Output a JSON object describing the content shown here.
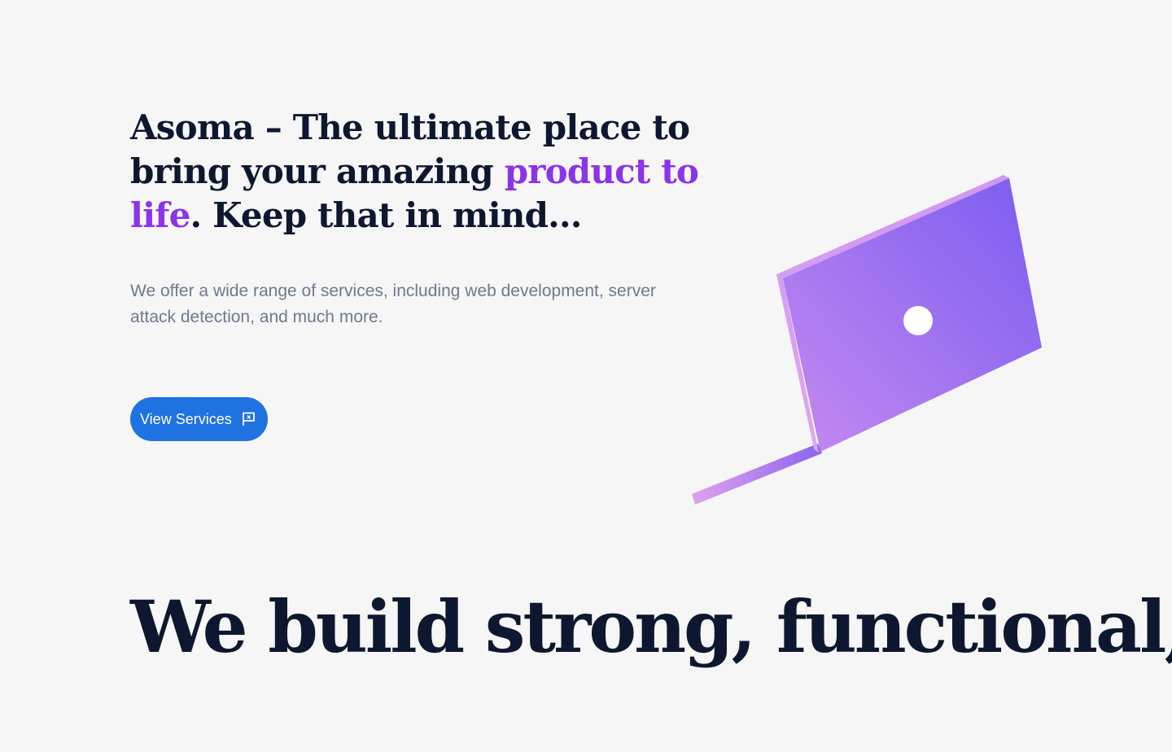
{
  "hero": {
    "title_part1": "Asoma – The ultimate place to bring your amazing ",
    "title_accent": "product to life",
    "title_part2": ". Keep that in mind...",
    "description": "We offer a wide range of services, including web development, server attack detection, and much more.",
    "cta_label": "View Services",
    "cta_icon": "flag-icon"
  },
  "section": {
    "heading": "We build strong, functional, and"
  },
  "colors": {
    "background": "#f6f6f6",
    "heading_text": "#0d1830",
    "accent_text": "#8b34e8",
    "body_text": "#6d7a90",
    "button_bg": "#1f72e2",
    "laptop_gradient_start": "#c48af0",
    "laptop_gradient_end": "#7b5cf0"
  }
}
